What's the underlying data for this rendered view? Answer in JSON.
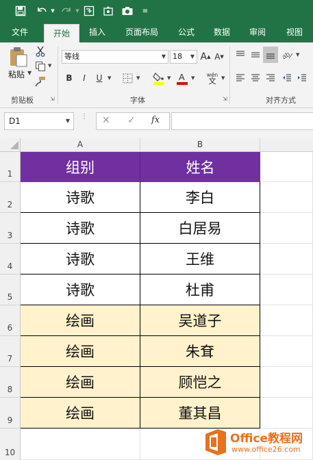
{
  "colors": {
    "excel_green": "#217346",
    "header_purple": "#7030a0",
    "highlight_beige": "#fff2cc",
    "watermark_orange": "#e8711e"
  },
  "quick_access": {
    "icons": [
      "save-icon",
      "undo-icon",
      "redo-icon",
      "format-painter-icon",
      "insert-shape-icon",
      "camera-icon",
      "customize-icon"
    ]
  },
  "tabs": [
    {
      "label": "文件",
      "active": false
    },
    {
      "label": "开始",
      "active": true
    },
    {
      "label": "插入",
      "active": false
    },
    {
      "label": "页面布局",
      "active": false
    },
    {
      "label": "公式",
      "active": false
    },
    {
      "label": "数据",
      "active": false
    },
    {
      "label": "审阅",
      "active": false
    },
    {
      "label": "视图",
      "active": false
    }
  ],
  "ribbon": {
    "clipboard": {
      "paste_label": "粘贴",
      "group_label": "剪贴板"
    },
    "font": {
      "font_name": "等线",
      "font_size": "18",
      "group_label": "字体",
      "grow": "A",
      "shrink": "A",
      "bold": "B",
      "italic": "I",
      "underline": "U",
      "phonetic": "wén"
    },
    "align": {
      "group_label": "对齐方式"
    }
  },
  "formula_bar": {
    "name_box": "D1",
    "fx_label": "fx",
    "formula": ""
  },
  "columns": [
    "A",
    "B"
  ],
  "rows": [
    "1",
    "2",
    "3",
    "4",
    "5",
    "6",
    "7",
    "8",
    "9",
    "10"
  ],
  "table": {
    "headers": [
      "组别",
      "姓名"
    ],
    "data": [
      [
        "诗歌",
        "李白"
      ],
      [
        "诗歌",
        "白居易"
      ],
      [
        "诗歌",
        "王维"
      ],
      [
        "诗歌",
        "杜甫"
      ],
      [
        "绘画",
        "吴道子"
      ],
      [
        "绘画",
        "朱耷"
      ],
      [
        "绘画",
        "顾恺之"
      ],
      [
        "绘画",
        "董其昌"
      ]
    ]
  },
  "watermark": {
    "title": "Office教程网",
    "url": "www.office26.com"
  }
}
